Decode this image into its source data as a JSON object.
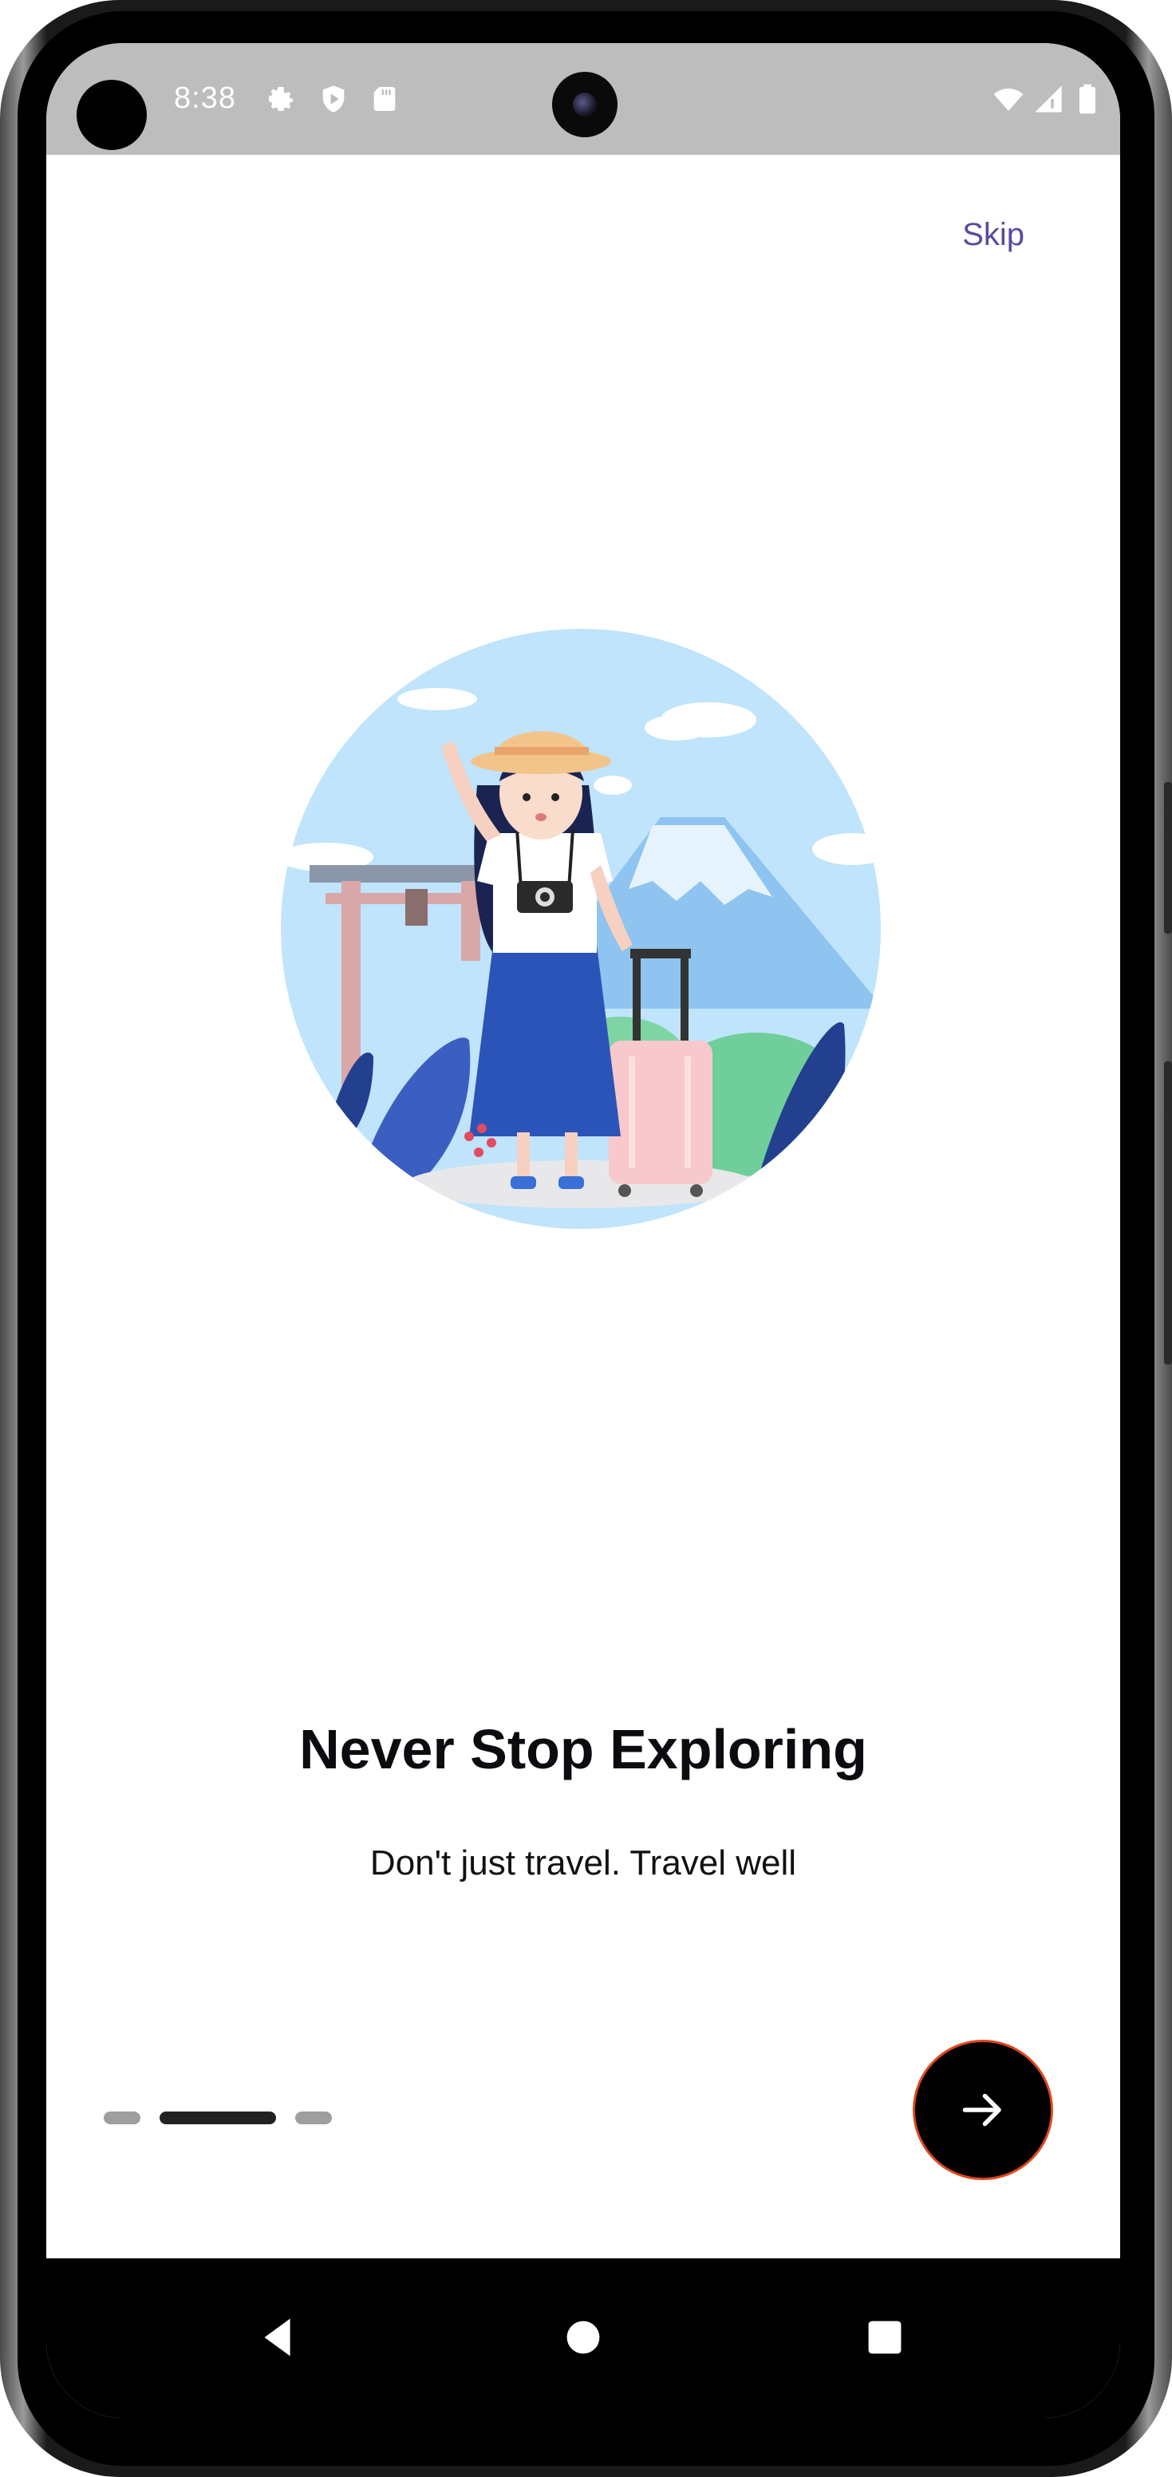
{
  "status_bar": {
    "time": "8:38",
    "left_icons": [
      "gear-icon",
      "shield-play-icon",
      "sd-card-icon"
    ],
    "right_icons": [
      "wifi-icon",
      "cellular-signal-icon",
      "battery-icon"
    ]
  },
  "onboarding": {
    "skip_label": "Skip",
    "title": "Never Stop Exploring",
    "subtitle": "Don't just travel. Travel well",
    "illustration": "traveler-girl-illustration",
    "page_indicator": {
      "total": 3,
      "current_index": 1
    },
    "next_icon": "arrow-right-icon"
  },
  "navigation_bar": {
    "buttons": [
      "back-icon",
      "home-icon",
      "recents-icon"
    ]
  },
  "colors": {
    "accent": "#5b4aa0",
    "next_button_border": "#e0481e",
    "status_bar_bg": "#bdbdbd",
    "indicator_active": "#222222",
    "indicator_inactive": "#9e9e9e",
    "sky_blue": "#bfe4fb"
  }
}
